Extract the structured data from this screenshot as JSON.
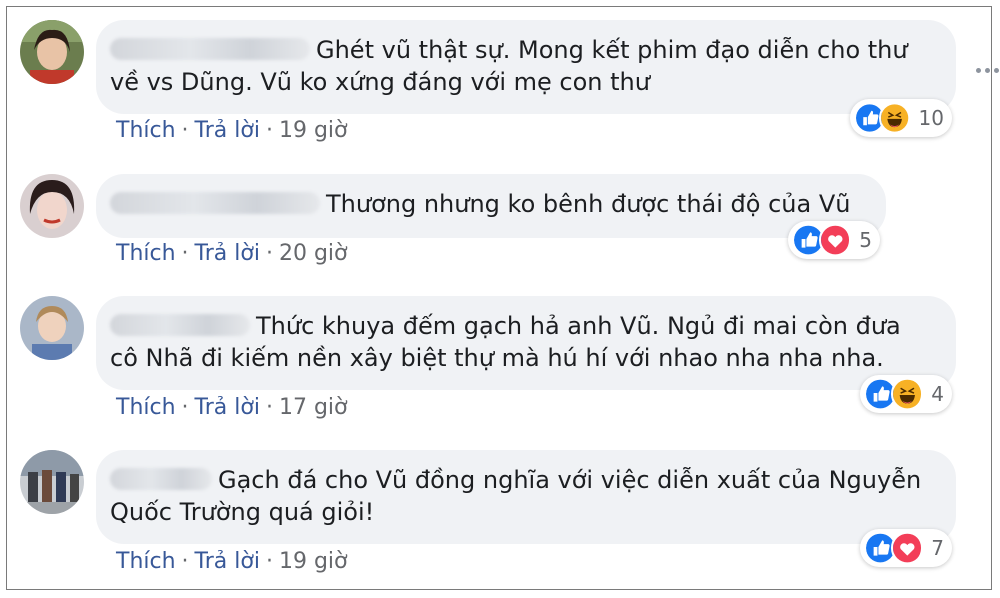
{
  "actions": {
    "like": "Thích",
    "reply": "Trả lời"
  },
  "comments": [
    {
      "text_line1": "Ghét vũ thật sự. Mong kết phim đạo diễn cho thư",
      "text_line2": "về vs Dũng. Vũ ko xứng đáng với mẹ con thư",
      "time": "19 giờ",
      "reactions": [
        "like",
        "haha"
      ],
      "count": "10"
    },
    {
      "text_line1": "Thương nhưng ko bênh được thái độ của Vũ",
      "time": "20 giờ",
      "reactions": [
        "like",
        "love"
      ],
      "count": "5"
    },
    {
      "text_line1": "Thức khuya đếm gạch hả anh Vũ. Ngủ đi mai còn đưa",
      "text_line2": "cô Nhã đi kiếm nền xây biệt thự mà hú hí với nhao nha nha nha.",
      "time": "17 giờ",
      "reactions": [
        "like",
        "haha"
      ],
      "count": "4"
    },
    {
      "text_line1": "Gạch đá cho Vũ đồng nghĩa với việc diễn xuất của Nguyễn",
      "text_line2": "Quốc Trường quá giỏi!",
      "time": "19 giờ",
      "reactions": [
        "like",
        "love"
      ],
      "count": "7"
    }
  ],
  "colors": {
    "link": "#385898",
    "bubble": "#f0f2f5",
    "like": "#1877f2",
    "love": "#f33e58",
    "haha": "#f7b125"
  },
  "icons": {
    "more": "more-horizontal-icon"
  }
}
